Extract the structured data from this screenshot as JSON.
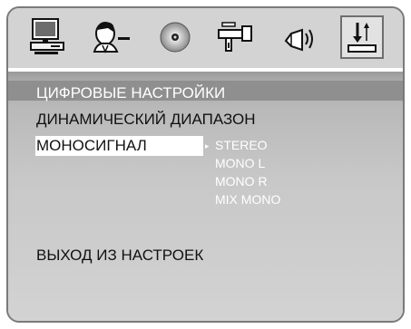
{
  "icons": [
    {
      "name": "monitor-icon",
      "selected": false
    },
    {
      "name": "person-icon",
      "selected": false
    },
    {
      "name": "disc-icon",
      "selected": false
    },
    {
      "name": "camera-icon",
      "selected": false
    },
    {
      "name": "speaker-icon",
      "selected": false
    },
    {
      "name": "sort-arrows-icon",
      "selected": true
    }
  ],
  "menu": {
    "digital_settings": "ЦИФРОВЫЕ НАСТРОЙКИ",
    "dynamic_range": "ДИНАМИЧЕСКИЙ ДИАПАЗОН",
    "mono_signal": "МОНОСИГНАЛ",
    "exit": "ВЫХОД ИЗ НАСТРОЕК"
  },
  "mono_options": {
    "selected_marker": "▸",
    "items": [
      "STEREO",
      "MONO L",
      "MONO R",
      "MIX MONO"
    ]
  },
  "colors": {
    "highlight": "#8f8f8f",
    "options_text": "#ffffff",
    "frame": "#7a7a7a"
  }
}
